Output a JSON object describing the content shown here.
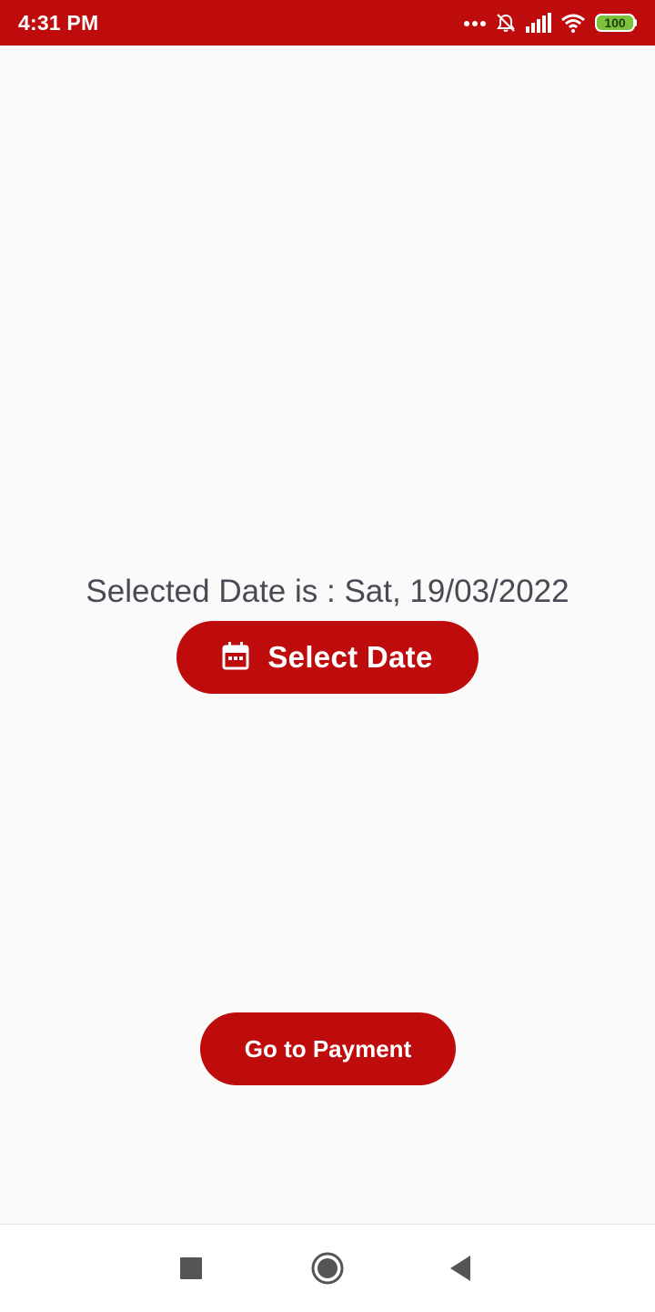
{
  "status_bar": {
    "time": "4:31 PM",
    "battery_level": "100",
    "icons": [
      "more-dots-icon",
      "alarm-off-icon",
      "signal-icon",
      "wifi-icon",
      "battery-icon"
    ],
    "background_color": "#be0b0b"
  },
  "main": {
    "selected_date_text": "Selected Date is : Sat, 19/03/2022",
    "select_date_button": {
      "label": "Select Date",
      "icon": "calendar-icon"
    },
    "payment_button": {
      "label": "Go to Payment"
    }
  },
  "nav_bar": {
    "buttons": [
      "recents-square-icon",
      "home-circle-icon",
      "back-triangle-icon"
    ]
  },
  "colors": {
    "accent": "#be0b0b",
    "text": "#4a4a55",
    "background": "#fafafa"
  }
}
